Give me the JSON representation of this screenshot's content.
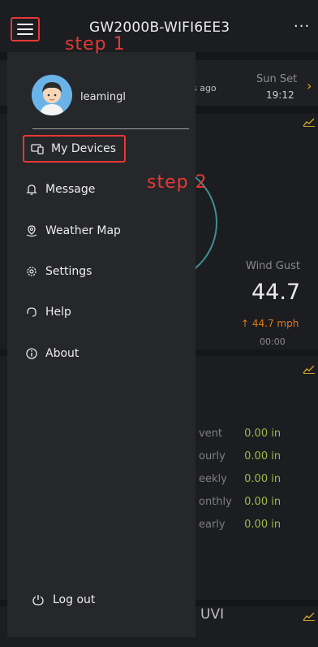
{
  "header": {
    "title": "GW2000B-WIFI6EE3",
    "more_label": "···"
  },
  "annotations": {
    "step1": "step 1",
    "step2": "step 2"
  },
  "drawer": {
    "username": "leamingl",
    "items": [
      {
        "label": "My Devices",
        "icon": "devices-icon"
      },
      {
        "label": "Message",
        "icon": "bell-icon"
      },
      {
        "label": "Weather Map",
        "icon": "map-pin-icon"
      },
      {
        "label": "Settings",
        "icon": "gear-icon"
      },
      {
        "label": "Help",
        "icon": "headset-icon"
      },
      {
        "label": "About",
        "icon": "info-icon"
      }
    ],
    "logout_label": "Log out"
  },
  "background": {
    "updated_text": "ds ago",
    "sunset_label": "Sun Set",
    "sunset_time": "19:12",
    "wind_gust_label": "Wind Gust",
    "wind_gust_value": "44.7",
    "wind_gust_mph": "↑ 44.7 mph",
    "wind_gust_time": "00:00",
    "rain_rows": [
      {
        "label": "vent",
        "value": "0.00 in"
      },
      {
        "label": "ourly",
        "value": "0.00 in"
      },
      {
        "label": "eekly",
        "value": "0.00 in"
      },
      {
        "label": "onthly",
        "value": "0.00 in"
      },
      {
        "label": "early",
        "value": "0.00 in"
      }
    ],
    "uvi_label": "UVI"
  },
  "colors": {
    "accent_red": "#e53935",
    "rain_value": "#9fb84a",
    "orange": "#e07a1f"
  }
}
